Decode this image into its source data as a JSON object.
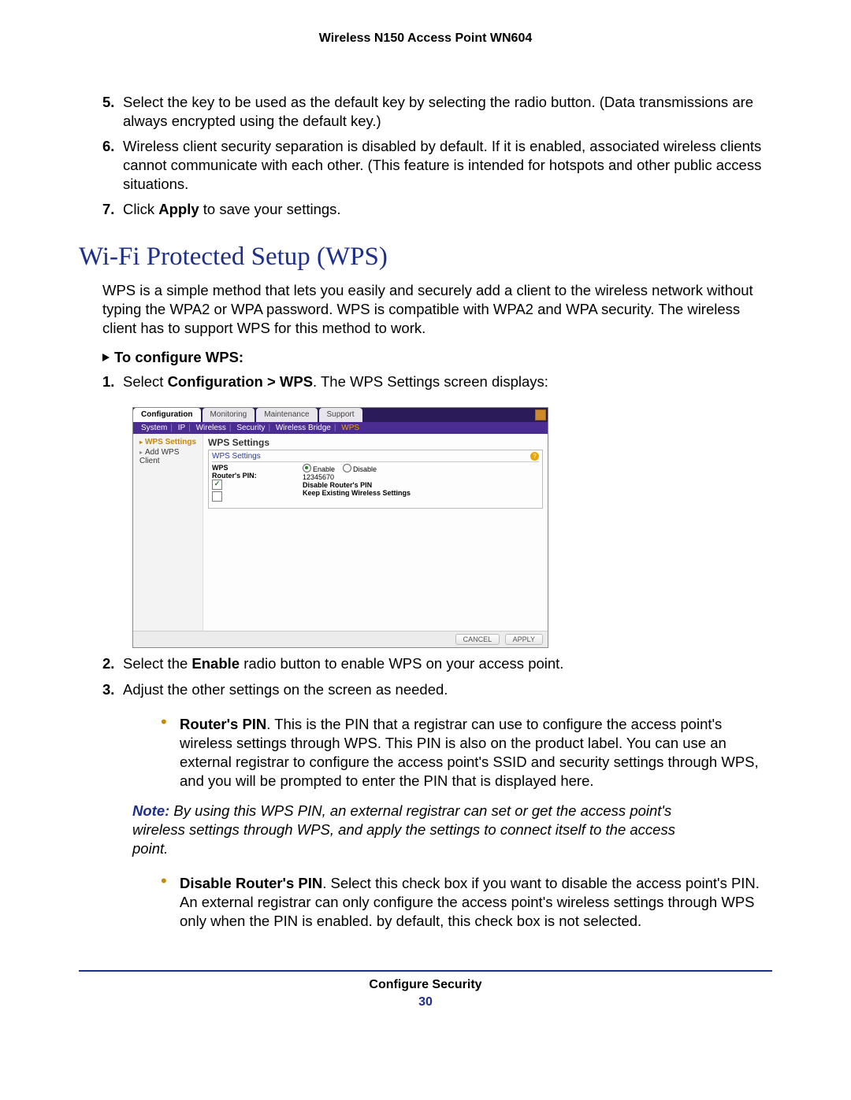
{
  "header": {
    "product": "Wireless N150 Access Point WN604"
  },
  "steps_top": {
    "s5": {
      "n": "5.",
      "t": "Select the key to be used as the default key by selecting the radio button. (Data transmissions are always encrypted using the default key.)"
    },
    "s6": {
      "n": "6.",
      "t": "Wireless client security separation is disabled by default. If it is enabled, associated wireless clients cannot communicate with each other. (This feature is intended for hotspots and other public access situations."
    },
    "s7": {
      "n": "7.",
      "t_pre": "Click ",
      "t_bold": "Apply",
      "t_post": " to save your settings."
    }
  },
  "section_title": "Wi-Fi Protected Setup (WPS)",
  "section_intro": "WPS is a simple method that lets you easily and securely add a client to the wireless network without typing the WPA2 or WPA password. WPS is compatible with WPA2 and WPA security. The wireless client has to support WPS for this method to work.",
  "subhead": "To configure WPS:",
  "steps_wps": {
    "s1": {
      "n": "1.",
      "t_pre": "Select ",
      "t_bold": "Configuration > WPS",
      "t_post": ". The WPS Settings screen displays:"
    },
    "s2": {
      "n": "2.",
      "t_pre": "Select the ",
      "t_bold": "Enable",
      "t_post": " radio button to enable WPS on your access point."
    },
    "s3": {
      "n": "3.",
      "t": "Adjust the other settings on the screen as needed."
    }
  },
  "bullets": {
    "b1": {
      "bold": "Router's PIN",
      "t": ". This is the PIN that a registrar can use to configure the access point's wireless settings through WPS. This PIN is also on the product label. You can use an external registrar to configure the access point's SSID and security settings through WPS, and you will be prompted to enter the PIN that is displayed here."
    },
    "b2": {
      "bold": "Disable Router's PIN",
      "t": ". Select this check box if you want to disable the access point's PIN. An external registrar can only configure the access point's wireless settings through WPS only when the PIN is enabled. by default, this check box is not selected."
    }
  },
  "note": {
    "label": "Note:",
    "text": "  By using this WPS PIN, an external registrar can set or get the access point's wireless settings through WPS, and apply the settings to connect itself to the access point."
  },
  "screenshot": {
    "tabs": [
      "Configuration",
      "Monitoring",
      "Maintenance",
      "Support"
    ],
    "subtabs": [
      "System",
      "IP",
      "Wireless",
      "Security",
      "Wireless Bridge",
      "WPS"
    ],
    "side": [
      "WPS Settings",
      "Add WPS Client"
    ],
    "panel_title": "WPS Settings",
    "panel_sub": "WPS Settings",
    "row_wps": "WPS",
    "row_pin": "Router's PIN:",
    "enable": "Enable",
    "disable": "Disable",
    "pin": "12345670",
    "opt1": "Disable Router's PIN",
    "opt2": "Keep Existing Wireless Settings",
    "btn_cancel": "CANCEL",
    "btn_apply": "APPLY"
  },
  "footer": {
    "title": "Configure Security",
    "page": "30"
  }
}
